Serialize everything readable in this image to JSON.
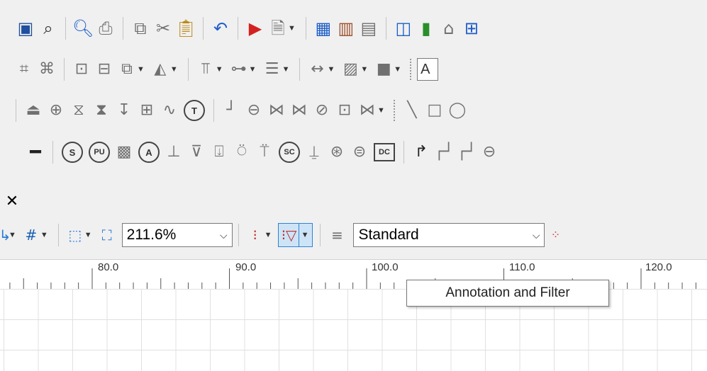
{
  "zoom": {
    "value": "211.6%"
  },
  "style_select": {
    "value": "Standard"
  },
  "tooltip": {
    "text": "Annotation and Filter"
  },
  "ruler": {
    "labels": [
      "80.0",
      "90.0",
      "100.0",
      "110.0",
      "120.0"
    ]
  },
  "row2_textbox_glimpse": "A",
  "symbols": {
    "s": "S",
    "pu": "PU",
    "a": "A",
    "t": "T",
    "sc": "SC",
    "dc": "DC"
  },
  "colors": {
    "accent_border": "#2f82d3",
    "pressed_bg": "#cde4f7",
    "tooltip_bg": "#ffffff"
  }
}
